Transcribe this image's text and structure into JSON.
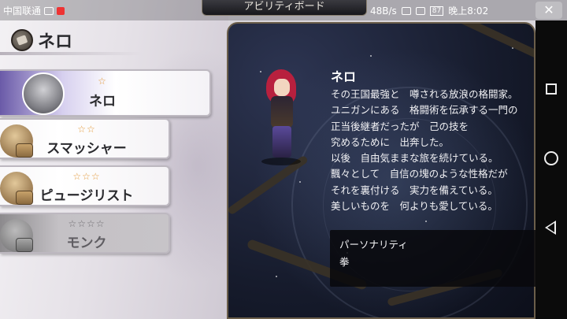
{
  "status_bar": {
    "carrier": "中国联通",
    "net_speed": "48B/s",
    "battery": "87",
    "time": "晚上8:02"
  },
  "screen_title": "アビリティボード",
  "close_label": "✕",
  "character": {
    "name": "ネロ"
  },
  "jobs": [
    {
      "stars": "☆",
      "name": "ネロ",
      "selected": true,
      "locked": false
    },
    {
      "stars": "☆☆",
      "name": "スマッシャー",
      "selected": false,
      "locked": false
    },
    {
      "stars": "☆☆☆",
      "name": "ピュージリスト",
      "selected": false,
      "locked": false
    },
    {
      "stars": "☆☆☆☆",
      "name": "モンク",
      "selected": false,
      "locked": true
    }
  ],
  "profile": {
    "name": "ネロ",
    "bio": "その王国最強と　噂される放浪の格闘家。\nユニガンにある　格闘術を伝承する一門の\n正当後継者だったが　己の技を\n究めるために　出奔した。\n以後　自由気ままな旅を続けている。\n飄々として　自信の塊のような性格だが\nそれを裏付ける　実力を備えている。\n美しいものを　何よりも愛している。",
    "personality_label": "パーソナリティ",
    "personality_value": "拳"
  },
  "colors": {
    "star_gold": "#e39a3c",
    "panel_dark": "#161b2c",
    "selected_purple": "#6a5aa8"
  },
  "icons": {
    "job_category": "fist-icon",
    "nav_recent": "square-icon",
    "nav_home": "circle-icon",
    "nav_back": "back-triangle-icon"
  }
}
